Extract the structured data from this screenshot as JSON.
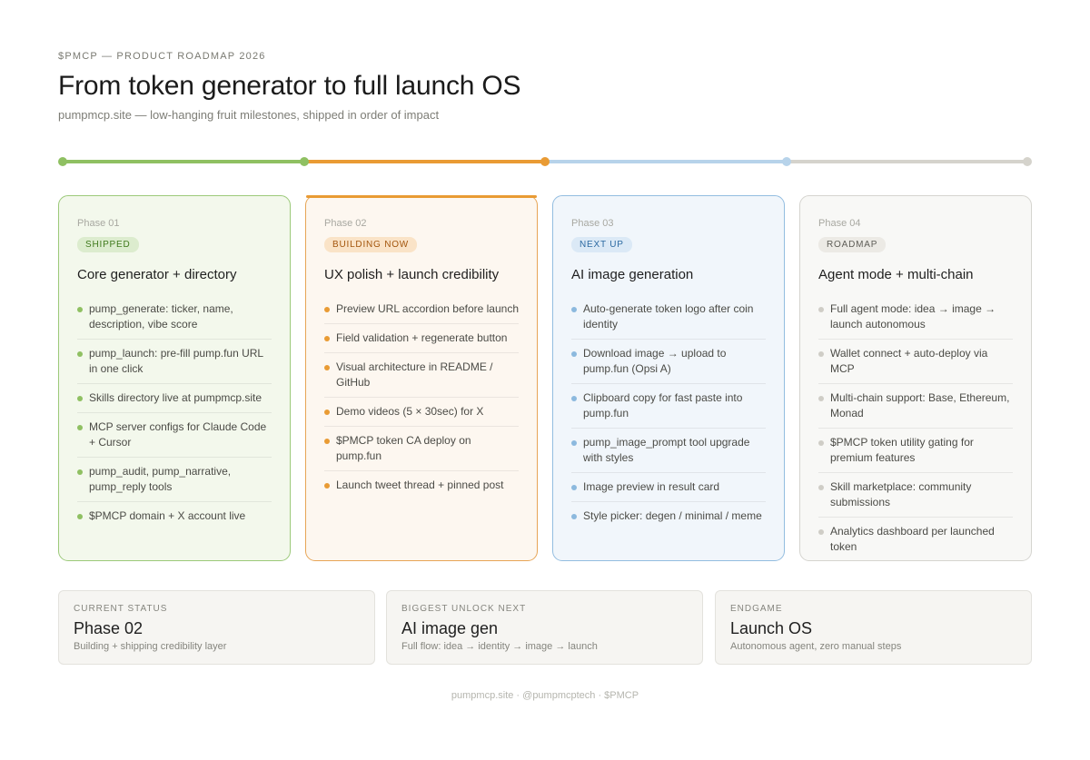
{
  "header": {
    "eyebrow": "$PMCP — PRODUCT ROADMAP 2026",
    "title": "From token generator to full launch OS",
    "subtitle": "pumpmcp.site — low-hanging fruit milestones, shipped in order of impact"
  },
  "colors": {
    "shipped": "#8fc062",
    "building": "#e99b34",
    "next": "#b7d3ea",
    "roadmap": "#d5d3cc"
  },
  "phases": [
    {
      "label": "Phase 01",
      "badge": "SHIPPED",
      "title": "Core generator + directory",
      "items": [
        "pump_generate: ticker, name, description, vibe score",
        "pump_launch: pre-fill pump.fun URL in one click",
        "Skills directory live at pumpmcp.site",
        "MCP server configs for Claude Code + Cursor",
        "pump_audit, pump_narrative, pump_reply tools",
        "$PMCP domain + X account live"
      ]
    },
    {
      "label": "Phase 02",
      "badge": "BUILDING NOW",
      "title": "UX polish + launch credibility",
      "items": [
        "Preview URL accordion before launch",
        "Field validation + regenerate button",
        "Visual architecture in README / GitHub",
        "Demo videos (5 × 30sec) for X",
        "$PMCP token CA deploy on pump.fun",
        "Launch tweet thread + pinned post"
      ]
    },
    {
      "label": "Phase 03",
      "badge": "NEXT UP",
      "title": "AI image generation",
      "items": [
        "Auto-generate token logo after coin identity",
        "Download image → upload to pump.fun (Opsi A)",
        "Clipboard copy for fast paste into pump.fun",
        "pump_image_prompt tool upgrade with styles",
        "Image preview in result card",
        "Style picker: degen / minimal / meme"
      ]
    },
    {
      "label": "Phase 04",
      "badge": "ROADMAP",
      "title": "Agent mode + multi-chain",
      "items": [
        "Full agent mode: idea → image → launch autonomous",
        "Wallet connect + auto-deploy via MCP",
        "Multi-chain support: Base, Ethereum, Monad",
        "$PMCP token utility gating for premium features",
        "Skill marketplace: community submissions",
        "Analytics dashboard per launched token"
      ]
    }
  ],
  "stats": [
    {
      "label": "CURRENT STATUS",
      "value": "Phase 02",
      "desc": "Building + shipping credibility layer"
    },
    {
      "label": "BIGGEST UNLOCK NEXT",
      "value": "AI image gen",
      "desc": "Full flow: idea → identity → image → launch"
    },
    {
      "label": "ENDGAME",
      "value": "Launch OS",
      "desc": "Autonomous agent, zero manual steps"
    }
  ],
  "footer": "pumpmcp.site · @pumpmcptech · $PMCP"
}
